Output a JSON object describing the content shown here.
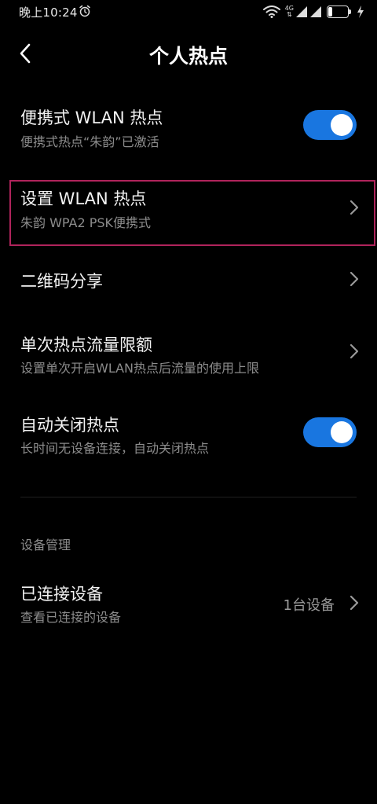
{
  "status_bar": {
    "time": "晚上10:24",
    "network_type": "4G",
    "battery_level": "21",
    "battery_fraction": 0.21
  },
  "header": {
    "title": "个人热点"
  },
  "rows": {
    "portable_hotspot": {
      "title": "便携式 WLAN 热点",
      "subtitle": "便携式热点“朱韵”已激活",
      "enabled": true
    },
    "setup_hotspot": {
      "title": "设置 WLAN 热点",
      "subtitle": "朱韵 WPA2 PSK便携式"
    },
    "qr_share": {
      "title": "二维码分享"
    },
    "data_limit": {
      "title": "单次热点流量限额",
      "subtitle": "设置单次开启WLAN热点后流量的使用上限"
    },
    "auto_off": {
      "title": "自动关闭热点",
      "subtitle": "长时间无设备连接，自动关闭热点",
      "enabled": true
    }
  },
  "device_section": {
    "header": "设备管理",
    "connected": {
      "title": "已连接设备",
      "subtitle": "查看已连接的设备",
      "value": "1台设备"
    }
  },
  "colors": {
    "background": "#000000",
    "toggle_on": "#1976e0",
    "highlight": "#b0245c",
    "secondary_text": "#8c8c8c"
  }
}
